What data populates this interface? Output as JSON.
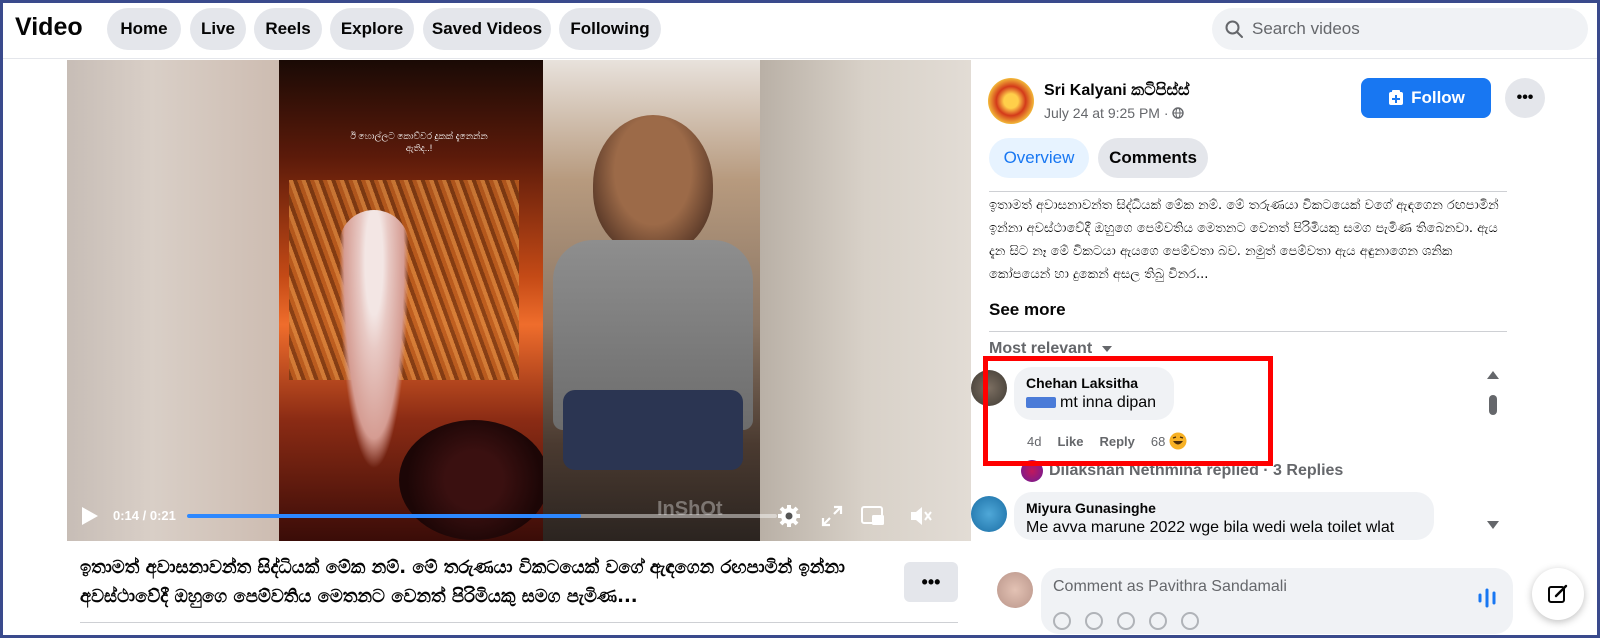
{
  "header": {
    "brand": "Video",
    "nav": [
      "Home",
      "Live",
      "Reels",
      "Explore",
      "Saved Videos",
      "Following"
    ],
    "search_placeholder": "Search videos"
  },
  "video": {
    "clip_caption": "ඊ හොල්ලට කොච්චර දුකක් දැනෙන්න ඇතිද..!",
    "watermark": "InShOt",
    "time": "0:14 / 0:21",
    "progress": 0.667
  },
  "caption": {
    "text": "ඉතාමත් අවාසනාවන්ත සිද්ධියක් මේක නම්. මේ තරුණයා විකටයෙක් වගේ ඇඳගෙන රඟපාමින් ඉන්නා අවස්ථාවේදී ඔහුගෙ පෙම්වතිය මෙතනට වෙනත් පිරිමියකු සමග පැමිණ...",
    "more_label": "•••"
  },
  "panel": {
    "page_name": "Sri Kalyani කටිපිස්ස්",
    "date": "July 24 at 9:25 PM ·",
    "follow_label": "Follow",
    "more_label": "•••",
    "tabs": [
      "Overview",
      "Comments"
    ],
    "description": "ඉතාමත් අවාසනාවන්ත සිද්ධියක් මේක නම්. මේ තරුණයා විකටයෙක් වගේ ඇඳගෙන රඟපාමින් ඉන්නා අවස්ථාවේදී ඔහුගෙ පෙම්වතිය මෙතනට වෙනත් පිරිමියකු සමග පැමිණ තිබෙනවා. ඇය දැන සිට නෑ මේ විකටයා ඇයගෙ පෙම්වතා බව. නමුත් පෙම්වතා ඇය අඳුනාගෙන ශනික කෝපයෙන් හා දුකෙන් අසල තිබු විනර...",
    "see_more": "See more",
    "sort_label": "Most relevant"
  },
  "comments": [
    {
      "author": "Chehan Laksitha",
      "text": "mt inna dipan",
      "age": "4d",
      "like": "Like",
      "reply": "Reply",
      "reactions": "68"
    },
    {
      "author": "Miyura Gunasinghe",
      "text": "Me avva marune 2022 wge bila wedi wela toilet wlat"
    }
  ],
  "replies_line": "Dilakshan Nethmina replied · 3 Replies",
  "comment_box": {
    "placeholder": "Comment as Pavithra Sandamali"
  },
  "colors": {
    "accent": "#1877f2",
    "highlight": "#ff0000",
    "pill": "#e4e6eb"
  }
}
